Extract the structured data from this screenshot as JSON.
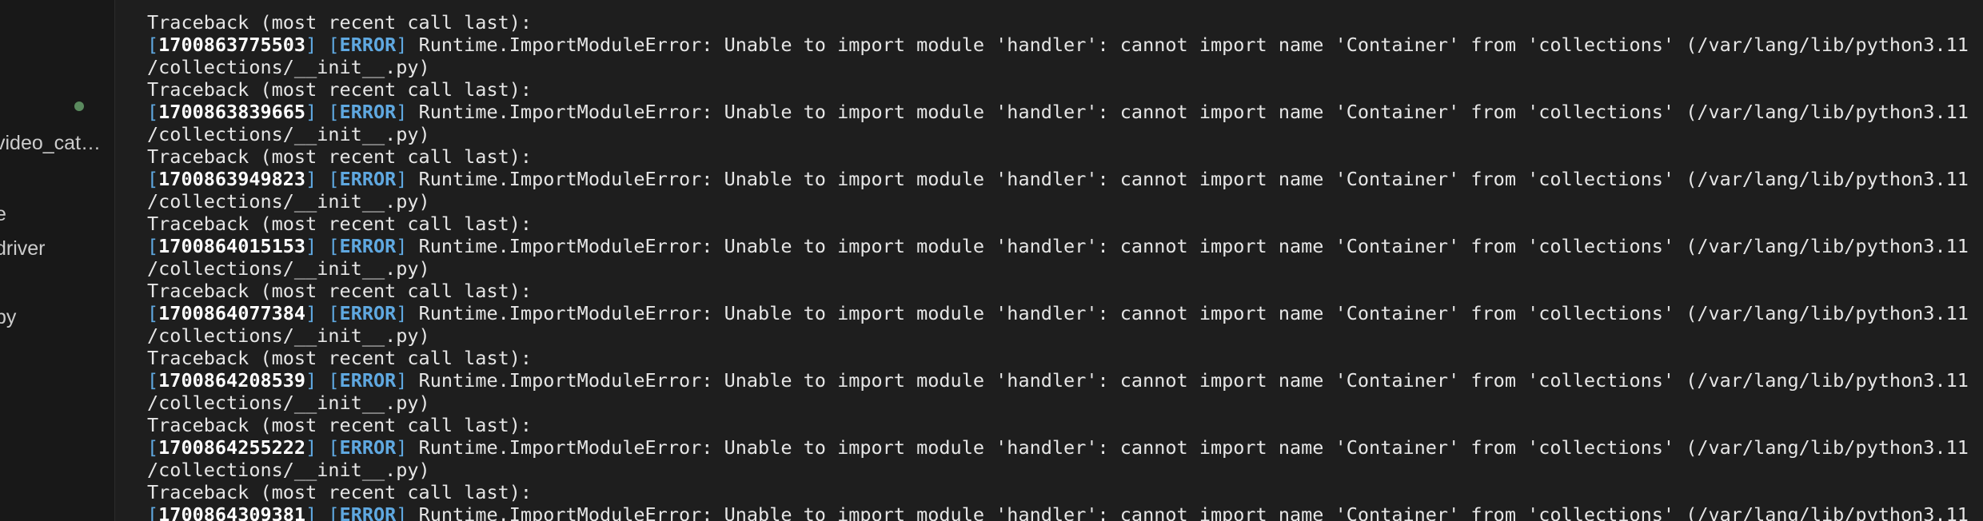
{
  "sidebar": {
    "items": [
      {
        "label": "video_cat…"
      },
      {
        "label": "e"
      },
      {
        "label": "driver"
      },
      {
        "label": "py"
      }
    ]
  },
  "terminal": {
    "traceback_label": "Traceback (most recent call last):",
    "error_level": "ERROR",
    "error_message": "Runtime.ImportModuleError: Unable to import module 'handler': cannot import name 'Container' from 'collections' (/var/lang/lib/python3.11",
    "path_continuation": "/collections/__init__.py)",
    "entries": [
      {
        "timestamp": "1700863775503"
      },
      {
        "timestamp": "1700863839665"
      },
      {
        "timestamp": "1700863949823"
      },
      {
        "timestamp": "1700864015153"
      },
      {
        "timestamp": "1700864077384"
      },
      {
        "timestamp": "1700864208539"
      },
      {
        "timestamp": "1700864255222"
      },
      {
        "timestamp": "1700864309381"
      }
    ]
  },
  "colors": {
    "background": "#1e1e1e",
    "sidebar_background": "#181818",
    "text": "#e6e6e6",
    "error_accent": "#5fa8e0",
    "status_dot": "#5a8a5e"
  }
}
